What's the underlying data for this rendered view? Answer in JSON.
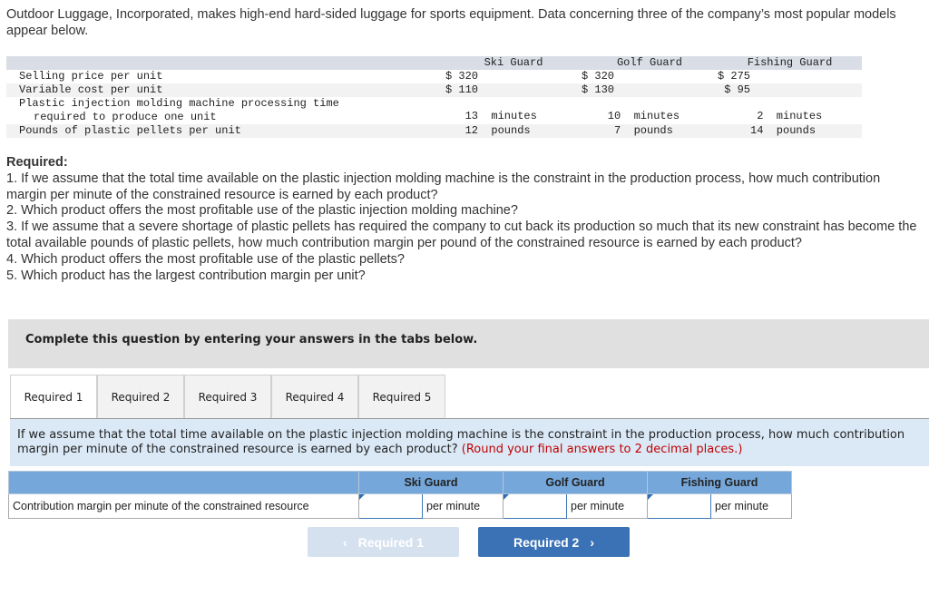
{
  "intro": "Outdoor Luggage, Incorporated, makes high-end hard-sided luggage for sports equipment. Data concerning three of the company’s most popular models appear below.",
  "data_table": {
    "columns": [
      "Ski Guard",
      "Golf Guard",
      "Fishing Guard"
    ],
    "rows": [
      {
        "label": "Selling price per unit",
        "values": [
          "$ 320",
          "$ 320",
          "$ 275"
        ]
      },
      {
        "label": "Variable cost per unit",
        "values": [
          "$ 110",
          "$ 130",
          " $ 95"
        ]
      },
      {
        "label": "Plastic injection molding machine processing time",
        "label2": "required to produce one unit",
        "values": [
          "   13  minutes",
          "    10  minutes",
          "      2  minutes"
        ]
      },
      {
        "label": "Pounds of plastic pellets per unit",
        "values": [
          "   12  pounds",
          "     7  pounds",
          "     14  pounds"
        ]
      }
    ]
  },
  "required": {
    "title": "Required:",
    "items": [
      "1. If we assume that the total time available on the plastic injection molding machine is the constraint in the production process, how much contribution margin per minute of the constrained resource is earned by each product?",
      "2. Which product offers the most profitable use of the plastic injection molding machine?",
      "3. If we assume that a severe shortage of plastic pellets has required the company to cut back its production so much that its new constraint has become the total available pounds of plastic pellets, how much contribution margin per pound of the constrained resource is earned by each product?",
      "4. Which product offers the most profitable use of the plastic pellets?",
      "5. Which product has the largest contribution margin per unit?"
    ]
  },
  "instruction": "Complete this question by entering your answers in the tabs below.",
  "tabs": [
    {
      "label": "Required 1",
      "active": true
    },
    {
      "label": "Required 2",
      "active": false
    },
    {
      "label": "Required 3",
      "active": false
    },
    {
      "label": "Required 4",
      "active": false
    },
    {
      "label": "Required 5",
      "active": false
    }
  ],
  "question": {
    "text": "If we assume that the total time available on the plastic injection molding machine is the constraint in the production process, how much contribution margin per minute of the constrained resource is earned by each product?",
    "hint": "(Round your final answers to 2 decimal places.)"
  },
  "answer_table": {
    "headers": [
      "Ski Guard",
      "Golf Guard",
      "Fishing Guard"
    ],
    "row_label": "Contribution margin per minute of the constrained resource",
    "unit": "per minute",
    "values": [
      "",
      "",
      ""
    ]
  },
  "nav": {
    "prev_label": "Required 1",
    "prev_icon": "‹",
    "next_label": "Required 2",
    "next_icon": "›"
  }
}
